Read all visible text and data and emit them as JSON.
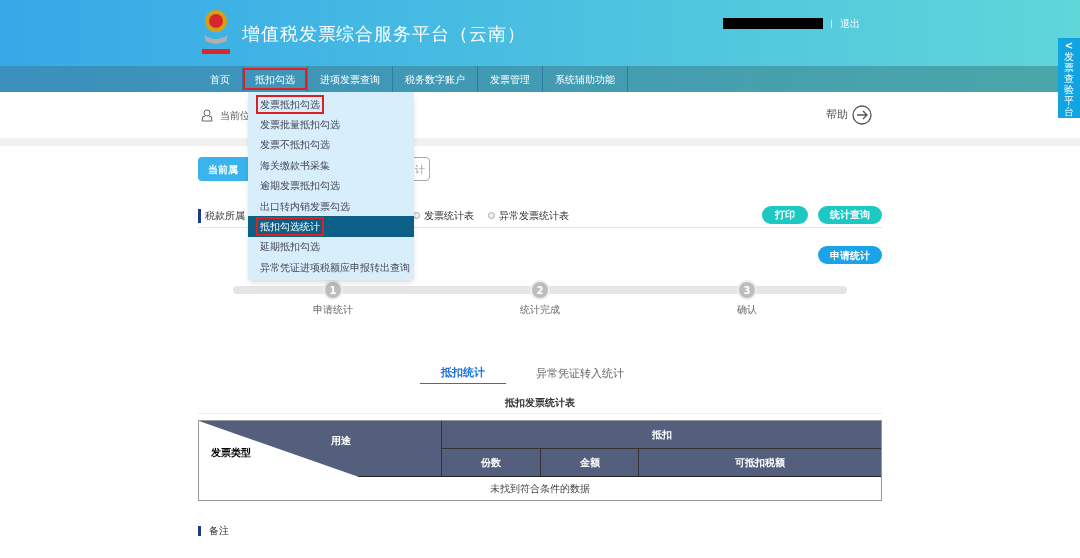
{
  "header": {
    "title": "增值税发票综合服务平台（云南）",
    "logout": "退出"
  },
  "side_tab": {
    "arrow": "<",
    "label": "发票查验平台"
  },
  "nav": [
    {
      "label": "首页",
      "highlighted": false
    },
    {
      "label": "抵扣勾选",
      "highlighted": true
    },
    {
      "label": "进项发票查询",
      "highlighted": false
    },
    {
      "label": "税务数字账户",
      "highlighted": false
    },
    {
      "label": "发票管理",
      "highlighted": false
    },
    {
      "label": "系统辅助功能",
      "highlighted": false
    }
  ],
  "dropdown": [
    {
      "label": "发票抵扣勾选",
      "selected": false,
      "highlighted": true
    },
    {
      "label": "发票批量抵扣勾选",
      "selected": false,
      "highlighted": false
    },
    {
      "label": "发票不抵扣勾选",
      "selected": false,
      "highlighted": false
    },
    {
      "label": "海关缴款书采集",
      "selected": false,
      "highlighted": false
    },
    {
      "label": "逾期发票抵扣勾选",
      "selected": false,
      "highlighted": false
    },
    {
      "label": "出口转内销发票勾选",
      "selected": false,
      "highlighted": false
    },
    {
      "label": "抵扣勾选统计",
      "selected": true,
      "highlighted": true
    },
    {
      "label": "延期抵扣勾选",
      "selected": false,
      "highlighted": false
    },
    {
      "label": "异常凭证进项税额应申报转出查询",
      "selected": false,
      "highlighted": false
    }
  ],
  "breadcrumb": "当前位",
  "help": "帮助",
  "period_buttons": [
    {
      "label": "当前属",
      "kind": "filled"
    },
    {
      "label": "计",
      "kind": "outline"
    }
  ],
  "filter": {
    "label": "税款所属",
    "radios": [
      {
        "label": "发票统计表",
        "selected": false
      },
      {
        "label": "异常发票统计表",
        "selected": false
      }
    ]
  },
  "actions": [
    "打印",
    "统计查询"
  ],
  "apply_button": "申请统计",
  "steps": [
    {
      "number": "1",
      "label": "申请统计"
    },
    {
      "number": "2",
      "label": "统计完成"
    },
    {
      "number": "3",
      "label": "确认"
    }
  ],
  "tabs": [
    {
      "label": "抵扣统计",
      "selected": true
    },
    {
      "label": "异常凭证转入统计",
      "selected": false
    }
  ],
  "table": {
    "title": "抵扣发票统计表",
    "corner_top": "用途",
    "corner_bottom": "发票类型",
    "group": "抵扣",
    "columns": [
      "份数",
      "金额",
      "可抵扣税额"
    ],
    "empty": "未找到符合条件的数据"
  },
  "remarks": "备注"
}
